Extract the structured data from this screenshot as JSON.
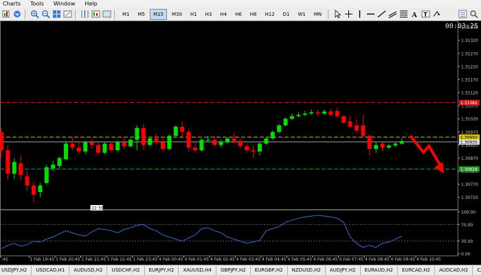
{
  "menu": [
    "Charts",
    "Tools",
    "Window",
    "Help"
  ],
  "timeframes": [
    {
      "label": "M1",
      "active": false
    },
    {
      "label": "M5",
      "active": false
    },
    {
      "label": "M15",
      "active": true
    },
    {
      "label": "M30",
      "active": false
    },
    {
      "label": "H1",
      "active": false
    },
    {
      "label": "H3",
      "active": false
    },
    {
      "label": "H4",
      "active": false
    },
    {
      "label": "H6",
      "active": false
    },
    {
      "label": "H8",
      "active": false
    },
    {
      "label": "H12",
      "active": false
    },
    {
      "label": "D1",
      "active": false
    },
    {
      "label": "W1",
      "active": false
    },
    {
      "label": "MN",
      "active": false
    }
  ],
  "clock": "00:03:25",
  "price_axis": [
    "1.31370",
    "1.31320",
    "1.31270",
    "1.31220",
    "1.31170",
    "1.31120",
    "1.31070",
    "1.31020",
    "1.30970",
    "1.30920",
    "1.30870",
    "1.30820",
    "1.30770",
    "1.30720"
  ],
  "levels": {
    "resistance": "1.31082",
    "current": "1.30950",
    "current_bid": "1.30935",
    "support": "1.30828"
  },
  "crosshair_label": "22:30",
  "oscillator_axis": [
    "100.00",
    "70.00",
    "30.00",
    "0.00"
  ],
  "time_axis": [
    ":45",
    "1 Feb 19:45",
    "1 Feb 20:45",
    "1 Feb 21:45",
    "1 Feb 22:45",
    "1 Feb 23:45",
    "4 Feb 00:45",
    "4 Feb 01:45",
    "4 Feb 02:45",
    "4 Feb 03:45",
    "4 Feb 04:45",
    "4 Feb 05:45",
    "4 Feb 06:45",
    "4 Feb 07:45",
    "4 Feb 08:45",
    "4 Feb 09:45",
    "4 Feb 10:45"
  ],
  "tabs": [
    "USDJPY,H2",
    "USDCAD,H1",
    "AUDUSD,H2",
    "USDCHF,H2",
    "EURJPY,H2",
    "XAUUSD,H4",
    "GBPJPY,H2",
    "EURGBP,H2",
    "NZDUSD,H2",
    "AUDJPY,H2",
    "EURAUD,H2",
    "EURCAD,H2",
    "AUDCAD,H2",
    "CAD"
  ],
  "colors": {
    "bull": "#00e000",
    "bear": "#ff0000",
    "resistance": "#d01818",
    "current": "#e0c000",
    "support": "#1f9a1f",
    "oscillator": "#3a6bd6",
    "arrow": "#ff0000"
  },
  "chart_data": {
    "type": "candlestick",
    "price_range": [
      1.3068,
      1.3139
    ],
    "candles": [
      {
        "o": 1.30968,
        "h": 1.30985,
        "c": 1.309,
        "l": 1.3087
      },
      {
        "o": 1.309,
        "h": 1.3092,
        "c": 1.3081,
        "l": 1.3079
      },
      {
        "o": 1.3081,
        "h": 1.3087,
        "c": 1.30855,
        "l": 1.3079
      },
      {
        "o": 1.3085,
        "h": 1.3088,
        "c": 1.30805,
        "l": 1.30785
      },
      {
        "o": 1.308,
        "h": 1.3082,
        "c": 1.30765,
        "l": 1.30745
      },
      {
        "o": 1.30765,
        "h": 1.3078,
        "c": 1.3073,
        "l": 1.307
      },
      {
        "o": 1.3074,
        "h": 1.30775,
        "c": 1.30765,
        "l": 1.3072
      },
      {
        "o": 1.30775,
        "h": 1.30845,
        "c": 1.30835,
        "l": 1.3077
      },
      {
        "o": 1.3083,
        "h": 1.3086,
        "c": 1.30845,
        "l": 1.3082
      },
      {
        "o": 1.3084,
        "h": 1.30875,
        "c": 1.3087,
        "l": 1.3083
      },
      {
        "o": 1.30865,
        "h": 1.30935,
        "c": 1.30925,
        "l": 1.3086
      },
      {
        "o": 1.30925,
        "h": 1.3095,
        "c": 1.3091,
        "l": 1.309
      },
      {
        "o": 1.3091,
        "h": 1.3093,
        "c": 1.30895,
        "l": 1.30885
      },
      {
        "o": 1.30895,
        "h": 1.30935,
        "c": 1.3093,
        "l": 1.30885
      },
      {
        "o": 1.3093,
        "h": 1.3094,
        "c": 1.3092,
        "l": 1.30905
      },
      {
        "o": 1.3092,
        "h": 1.3093,
        "c": 1.3089,
        "l": 1.3088
      },
      {
        "o": 1.3089,
        "h": 1.3093,
        "c": 1.30925,
        "l": 1.30885
      },
      {
        "o": 1.30925,
        "h": 1.3093,
        "c": 1.309,
        "l": 1.30895
      },
      {
        "o": 1.309,
        "h": 1.30935,
        "c": 1.3093,
        "l": 1.30895
      },
      {
        "o": 1.3093,
        "h": 1.30945,
        "c": 1.30915,
        "l": 1.30905
      },
      {
        "o": 1.30915,
        "h": 1.30945,
        "c": 1.3094,
        "l": 1.3091
      },
      {
        "o": 1.3094,
        "h": 1.30995,
        "c": 1.30985,
        "l": 1.309
      },
      {
        "o": 1.30985,
        "h": 1.31,
        "c": 1.3092,
        "l": 1.309
      },
      {
        "o": 1.3092,
        "h": 1.3095,
        "c": 1.30945,
        "l": 1.30915
      },
      {
        "o": 1.30945,
        "h": 1.3096,
        "c": 1.3093,
        "l": 1.3092
      },
      {
        "o": 1.3093,
        "h": 1.3095,
        "c": 1.30905,
        "l": 1.30895
      },
      {
        "o": 1.30905,
        "h": 1.3096,
        "c": 1.30955,
        "l": 1.309
      },
      {
        "o": 1.30955,
        "h": 1.30995,
        "c": 1.3099,
        "l": 1.3095
      },
      {
        "o": 1.3099,
        "h": 1.3101,
        "c": 1.3097,
        "l": 1.30945
      },
      {
        "o": 1.3097,
        "h": 1.3098,
        "c": 1.3091,
        "l": 1.30895
      },
      {
        "o": 1.3091,
        "h": 1.30935,
        "c": 1.309,
        "l": 1.3089
      },
      {
        "o": 1.309,
        "h": 1.30945,
        "c": 1.3094,
        "l": 1.30895
      },
      {
        "o": 1.3094,
        "h": 1.30955,
        "c": 1.3094,
        "l": 1.3093
      },
      {
        "o": 1.3094,
        "h": 1.30955,
        "c": 1.3092,
        "l": 1.30915
      },
      {
        "o": 1.3092,
        "h": 1.3094,
        "c": 1.3093,
        "l": 1.3091
      },
      {
        "o": 1.3093,
        "h": 1.3095,
        "c": 1.30945,
        "l": 1.30925
      },
      {
        "o": 1.30945,
        "h": 1.30965,
        "c": 1.30935,
        "l": 1.30925
      },
      {
        "o": 1.30935,
        "h": 1.30945,
        "c": 1.30915,
        "l": 1.30905
      },
      {
        "o": 1.30915,
        "h": 1.30925,
        "c": 1.309,
        "l": 1.3089
      },
      {
        "o": 1.309,
        "h": 1.3092,
        "c": 1.30895,
        "l": 1.3087
      },
      {
        "o": 1.30895,
        "h": 1.3093,
        "c": 1.30925,
        "l": 1.3088
      },
      {
        "o": 1.30925,
        "h": 1.3095,
        "c": 1.30945,
        "l": 1.3092
      },
      {
        "o": 1.30945,
        "h": 1.30975,
        "c": 1.3097,
        "l": 1.3094
      },
      {
        "o": 1.3097,
        "h": 1.31,
        "c": 1.30995,
        "l": 1.30965
      },
      {
        "o": 1.30995,
        "h": 1.31025,
        "c": 1.3102,
        "l": 1.3099
      },
      {
        "o": 1.3102,
        "h": 1.3104,
        "c": 1.3103,
        "l": 1.31015
      },
      {
        "o": 1.3103,
        "h": 1.31045,
        "c": 1.31035,
        "l": 1.31025
      },
      {
        "o": 1.31035,
        "h": 1.3105,
        "c": 1.3104,
        "l": 1.3103
      },
      {
        "o": 1.3104,
        "h": 1.31055,
        "c": 1.31045,
        "l": 1.31035
      },
      {
        "o": 1.31045,
        "h": 1.31055,
        "c": 1.3104,
        "l": 1.3103
      },
      {
        "o": 1.3104,
        "h": 1.31055,
        "c": 1.31048,
        "l": 1.31035
      },
      {
        "o": 1.31048,
        "h": 1.3106,
        "c": 1.31035,
        "l": 1.3103
      },
      {
        "o": 1.3105,
        "h": 1.3106,
        "c": 1.3103,
        "l": 1.31025
      },
      {
        "o": 1.3103,
        "h": 1.31035,
        "c": 1.31005,
        "l": 1.31
      },
      {
        "o": 1.3101,
        "h": 1.3103,
        "c": 1.3099,
        "l": 1.30985
      },
      {
        "o": 1.30995,
        "h": 1.3102,
        "c": 1.30975,
        "l": 1.30965
      },
      {
        "o": 1.30995,
        "h": 1.31035,
        "c": 1.30955,
        "l": 1.3095
      },
      {
        "o": 1.30955,
        "h": 1.3096,
        "c": 1.30905,
        "l": 1.3088
      },
      {
        "o": 1.30905,
        "h": 1.3093,
        "c": 1.3092,
        "l": 1.3089
      },
      {
        "o": 1.30925,
        "h": 1.3093,
        "c": 1.3091,
        "l": 1.30895
      },
      {
        "o": 1.3091,
        "h": 1.30925,
        "c": 1.30918,
        "l": 1.30905
      },
      {
        "o": 1.30918,
        "h": 1.3093,
        "c": 1.30925,
        "l": 1.30912
      },
      {
        "o": 1.30925,
        "h": 1.30945,
        "c": 1.30935,
        "l": 1.3092
      }
    ],
    "oscillator": [
      12,
      20,
      25,
      18,
      22,
      30,
      28,
      35,
      40,
      48,
      55,
      50,
      45,
      42,
      52,
      60,
      58,
      55,
      50,
      58,
      62,
      68,
      70,
      60,
      55,
      45,
      40,
      35,
      30,
      38,
      45,
      60,
      62,
      55,
      50,
      40,
      35,
      30,
      25,
      28,
      32,
      55,
      60,
      65,
      75,
      80,
      85,
      88,
      90,
      92,
      90,
      88,
      85,
      75,
      40,
      25,
      15,
      20,
      15,
      25,
      28,
      35,
      42
    ]
  }
}
